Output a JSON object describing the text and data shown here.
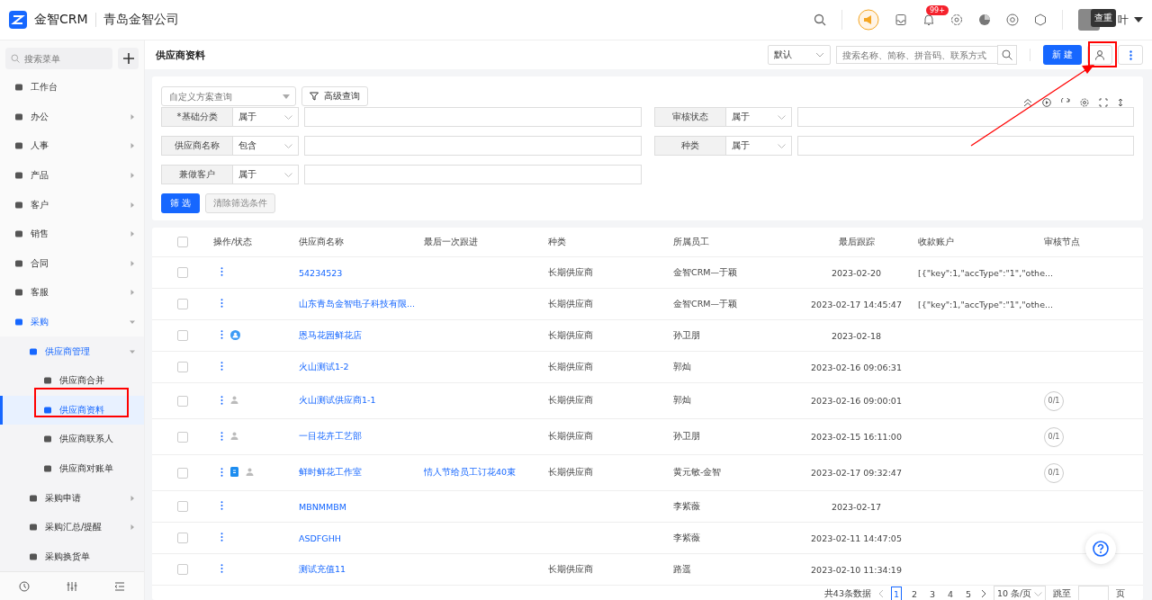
{
  "header": {
    "brand": "金智CRM",
    "company": "青岛金智公司",
    "notification_badge": "99+",
    "user_name": "叶",
    "tooltip": "查重"
  },
  "sidebar": {
    "search_placeholder": "搜索菜单",
    "items": [
      {
        "label": "工作台",
        "selected": false
      },
      {
        "label": "办公",
        "selected": false,
        "expanded": false
      },
      {
        "label": "人事",
        "selected": false,
        "expanded": false
      },
      {
        "label": "产品",
        "selected": false,
        "expanded": false
      },
      {
        "label": "客户",
        "selected": false,
        "expanded": false
      },
      {
        "label": "销售",
        "selected": false,
        "expanded": false
      },
      {
        "label": "合同",
        "selected": false,
        "expanded": false
      },
      {
        "label": "客服",
        "selected": false,
        "expanded": false
      },
      {
        "label": "采购",
        "selected": false,
        "expanded": true,
        "children": [
          {
            "label": "供应商管理",
            "selected": false,
            "expanded": true,
            "children": [
              {
                "label": "供应商合并",
                "selected": false
              },
              {
                "label": "供应商资料",
                "selected": true
              },
              {
                "label": "供应商联系人",
                "selected": false
              },
              {
                "label": "供应商对账单",
                "selected": false
              }
            ]
          },
          {
            "label": "采购申请",
            "selected": false,
            "expanded": false
          },
          {
            "label": "采购汇总/提醒",
            "selected": false,
            "expanded": false
          },
          {
            "label": "采购换货单",
            "selected": false
          }
        ]
      }
    ]
  },
  "page": {
    "title": "供应商资料",
    "view_select": "默认",
    "search_placeholder": "搜索名称、简称、拼音码、联系方式",
    "new_button": "新 建"
  },
  "filter": {
    "scheme_placeholder": "自定义方案查询",
    "advanced_button": "高级查询",
    "fields": [
      {
        "label": "*基础分类",
        "operator": "属于"
      },
      {
        "label": "审核状态",
        "operator": "属于"
      },
      {
        "label": "供应商名称",
        "operator": "包含"
      },
      {
        "label": "种类",
        "operator": "属于"
      },
      {
        "label": "兼做客户",
        "operator": "属于"
      }
    ],
    "apply_button": "筛 选",
    "clear_button": "清除筛选条件"
  },
  "table": {
    "all_checked": false,
    "columns": [
      "操作/状态",
      "供应商名称",
      "最后一次跟进",
      "种类",
      "所属员工",
      "最后跟踪",
      "收款账户",
      "审核节点"
    ],
    "rows": [
      {
        "checked": false,
        "contact_status": false,
        "document_status": false,
        "person_status": false,
        "name": "54234523",
        "last_followup": "",
        "category": "长期供应商",
        "employee": "金智CRM—于颖",
        "last_track": "2023-02-20",
        "account": "[{\"key\":1,\"accType\":\"1\",\"othe...",
        "approval": ""
      },
      {
        "checked": false,
        "contact_status": false,
        "document_status": false,
        "person_status": false,
        "name": "山东青岛金智电子科技有限...",
        "last_followup": "",
        "category": "长期供应商",
        "employee": "金智CRM—于颖",
        "last_track": "2023-02-17 14:45:47",
        "account": "[{\"key\":1,\"accType\":\"1\",\"othe...",
        "approval": ""
      },
      {
        "checked": false,
        "contact_status": true,
        "document_status": false,
        "person_status": false,
        "name": "恩马花园鲜花店",
        "last_followup": "",
        "category": "长期供应商",
        "employee": "孙卫朋",
        "last_track": "2023-02-18",
        "account": "",
        "approval": ""
      },
      {
        "checked": false,
        "contact_status": false,
        "document_status": false,
        "person_status": false,
        "name": "火山测试1-2",
        "last_followup": "",
        "category": "长期供应商",
        "employee": "郭灿",
        "last_track": "2023-02-16 09:06:31",
        "account": "",
        "approval": ""
      },
      {
        "checked": false,
        "contact_status": false,
        "document_status": false,
        "person_status": true,
        "name": "火山测试供应商1-1",
        "last_followup": "",
        "category": "长期供应商",
        "employee": "郭灿",
        "last_track": "2023-02-16 09:00:01",
        "account": "",
        "approval": "0/1"
      },
      {
        "checked": false,
        "contact_status": false,
        "document_status": false,
        "person_status": true,
        "name": "一目花卉工艺部",
        "last_followup": "",
        "category": "长期供应商",
        "employee": "孙卫朋",
        "last_track": "2023-02-15 16:11:00",
        "account": "",
        "approval": "0/1"
      },
      {
        "checked": false,
        "contact_status": false,
        "document_status": true,
        "person_status": true,
        "name": "鲜时鲜花工作室",
        "last_followup": "情人节给员工订花40束",
        "category": "长期供应商",
        "employee": "黄元敏-金智",
        "last_track": "2023-02-17 09:32:47",
        "account": "",
        "approval": "0/1"
      },
      {
        "checked": false,
        "contact_status": false,
        "document_status": false,
        "person_status": false,
        "name": "MBNMMBM",
        "last_followup": "",
        "category": "",
        "employee": "李紫薇",
        "last_track": "2023-02-17",
        "account": "",
        "approval": ""
      },
      {
        "checked": false,
        "contact_status": false,
        "document_status": false,
        "person_status": false,
        "name": "ASDFGHH",
        "last_followup": "",
        "category": "",
        "employee": "李紫薇",
        "last_track": "2023-02-11 14:47:05",
        "account": "",
        "approval": ""
      },
      {
        "checked": false,
        "contact_status": false,
        "document_status": false,
        "person_status": false,
        "name": "测试充值11",
        "last_followup": "",
        "category": "长期供应商",
        "employee": "路遥",
        "last_track": "2023-02-10 11:34:19",
        "account": "",
        "approval": ""
      }
    ]
  },
  "pagination": {
    "total": "共43条数据",
    "pages": [
      {
        "label": "1",
        "selected": true
      },
      {
        "label": "2",
        "selected": false
      },
      {
        "label": "3",
        "selected": false
      },
      {
        "label": "4",
        "selected": false
      },
      {
        "label": "5",
        "selected": false
      }
    ],
    "page_size": "10 条/页",
    "jump_label": "跳至",
    "page_unit": "页"
  }
}
